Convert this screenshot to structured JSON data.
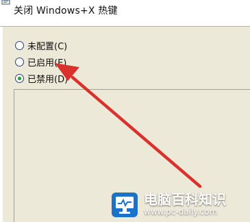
{
  "header": {
    "title": "关闭 Windows+X 热键",
    "icon": "policy-icon"
  },
  "options": {
    "not_configured": "未配置(C)",
    "enabled": "已启用(E)",
    "disabled": "已禁用(D)",
    "selected": "disabled"
  },
  "annotation": {
    "type": "arrow",
    "color": "#d9322c",
    "target": "enabled"
  },
  "watermark": {
    "title": "电脑百科知识",
    "url": "www.pc-daily.com",
    "icon": "monitor-icon",
    "color": "#1a73c8"
  }
}
